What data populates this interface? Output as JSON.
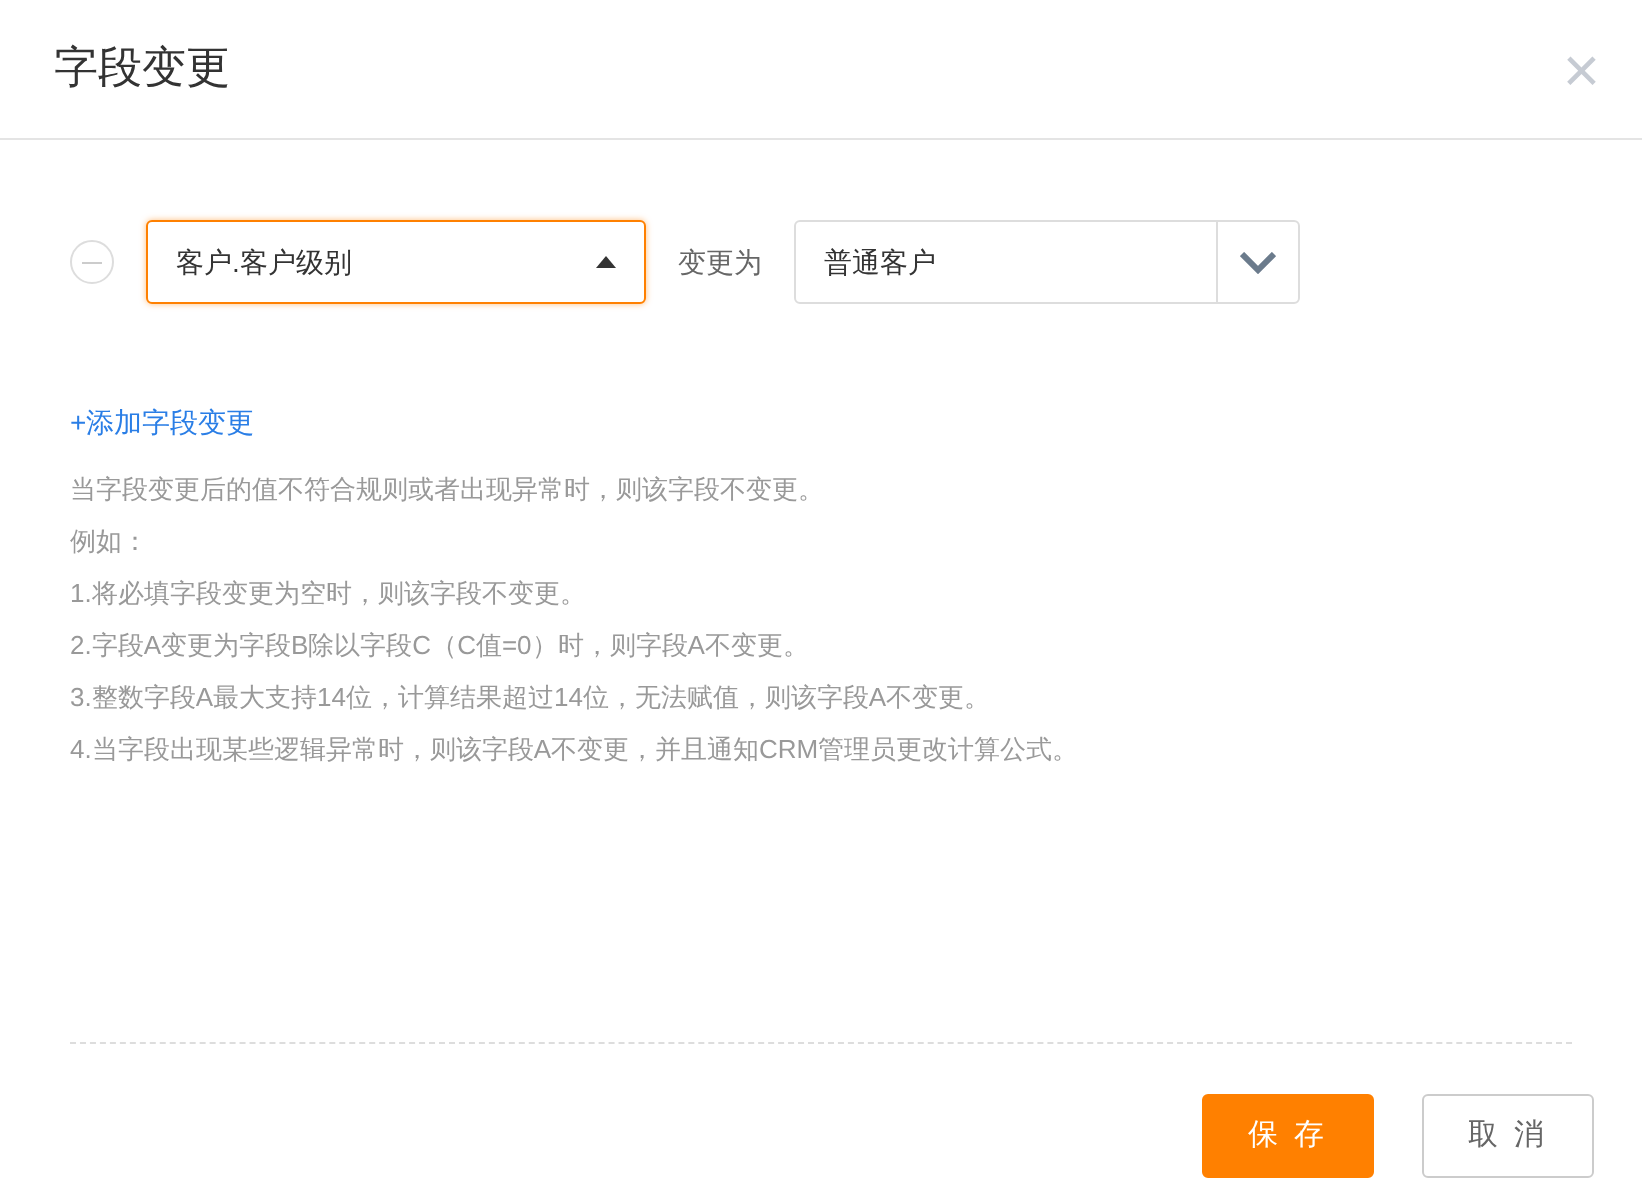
{
  "dialog": {
    "title": "字段变更",
    "close": "×"
  },
  "rules": [
    {
      "field": {
        "value": "客户.客户级别",
        "open": true
      },
      "connector": "变更为",
      "target": {
        "value": "普通客户",
        "open": false
      }
    }
  ],
  "add_link": "+添加字段变更",
  "notes": [
    "当字段变更后的值不符合规则或者出现异常时，则该字段不变更。",
    "例如：",
    "1.将必填字段变更为空时，则该字段不变更。",
    "2.字段A变更为字段B除以字段C（C值=0）时，则字段A不变更。",
    "3.整数字段A最大支持14位，计算结果超过14位，无法赋值，则该字段A不变更。",
    "4.当字段出现某些逻辑异常时，则该字段A不变更，并且通知CRM管理员更改计算公式。"
  ],
  "buttons": [
    {
      "label": "保 存",
      "kind": "primary"
    },
    {
      "label": "取 消",
      "kind": "secondary"
    }
  ]
}
